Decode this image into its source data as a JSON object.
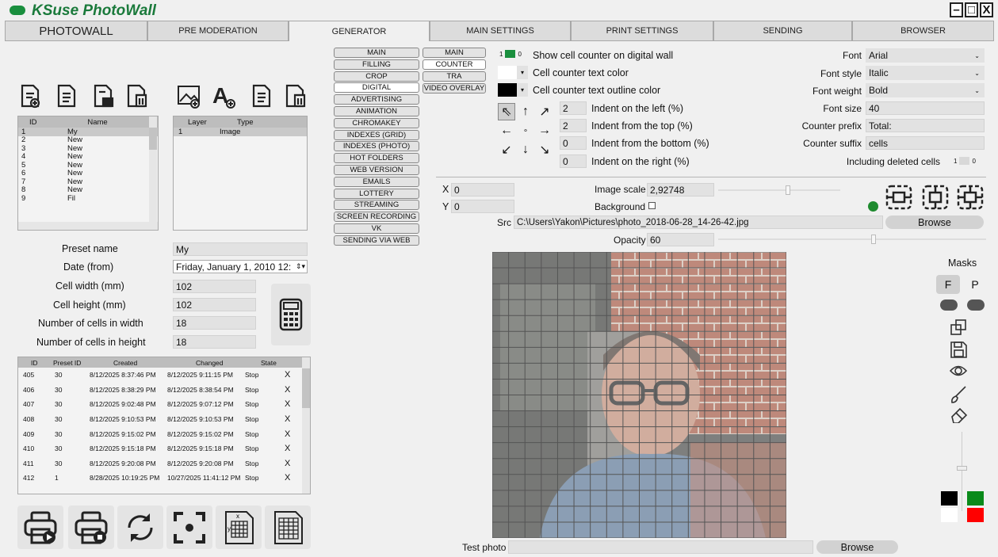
{
  "app": {
    "title": "KSuse PhotoWall"
  },
  "window_controls": {
    "minimize": "–",
    "maximize": "□",
    "close": "X"
  },
  "tabs": [
    "PHOTOWALL",
    "PRE MODERATION",
    "GENERATOR",
    "MAIN SETTINGS",
    "PRINT SETTINGS",
    "SENDING",
    "BROWSER"
  ],
  "presets_table": {
    "headers": [
      "ID",
      "Name"
    ],
    "rows": [
      [
        "1",
        "My"
      ],
      [
        "2",
        "New"
      ],
      [
        "3",
        "New"
      ],
      [
        "4",
        "New"
      ],
      [
        "5",
        "New"
      ],
      [
        "6",
        "New"
      ],
      [
        "7",
        "New"
      ],
      [
        "8",
        "New"
      ],
      [
        "9",
        "Fil"
      ]
    ]
  },
  "layers_table": {
    "headers": [
      "Layer",
      "Type"
    ],
    "rows": [
      [
        "1",
        "Image"
      ]
    ]
  },
  "preset_form": {
    "preset_name_label": "Preset name",
    "preset_name": "My",
    "date_label": "Date (from)",
    "date": "Friday, January 1, 2010 12:",
    "cell_width_label": "Cell width (mm)",
    "cell_width": "102",
    "cell_height_label": "Cell height (mm)",
    "cell_height": "102",
    "cells_w_label": "Number of cells in width",
    "cells_w": "18",
    "cells_h_label": "Number of cells in height",
    "cells_h": "18"
  },
  "jobs_table": {
    "headers": [
      "ID",
      "Preset ID",
      "Created",
      "Changed",
      "State"
    ],
    "rows": [
      [
        "405",
        "30",
        "8/12/2025 8:37:46 PM",
        "8/12/2025 9:11:15 PM",
        "Stop"
      ],
      [
        "406",
        "30",
        "8/12/2025 8:38:29 PM",
        "8/12/2025 8:38:54 PM",
        "Stop"
      ],
      [
        "407",
        "30",
        "8/12/2025 9:02:48 PM",
        "8/12/2025 9:07:12 PM",
        "Stop"
      ],
      [
        "408",
        "30",
        "8/12/2025 9:10:53 PM",
        "8/12/2025 9:10:53 PM",
        "Stop"
      ],
      [
        "409",
        "30",
        "8/12/2025 9:15:02 PM",
        "8/12/2025 9:15:02 PM",
        "Stop"
      ],
      [
        "410",
        "30",
        "8/12/2025 9:15:18 PM",
        "8/12/2025 9:15:18 PM",
        "Stop"
      ],
      [
        "411",
        "30",
        "8/12/2025 9:20:08 PM",
        "8/12/2025 9:20:08 PM",
        "Stop"
      ],
      [
        "412",
        "1",
        "8/28/2025 10:19:25 PM",
        "10/27/2025 11:41:12 PM",
        "Stop"
      ]
    ],
    "delete_mark": "X"
  },
  "gen_menu": [
    "MAIN",
    "FILLING",
    "CROP",
    "DIGITAL",
    "ADVERTISING",
    "ANIMATION",
    "CHROMAKEY",
    "INDEXES (GRID)",
    "INDEXES (PHOTO)",
    "HOT FOLDERS",
    "WEB VERSION",
    "EMAILS",
    "LOTTERY",
    "STREAMING",
    "SCREEN RECORDING",
    "VK",
    "SENDING VIA WEB"
  ],
  "sub_menu": [
    "MAIN",
    "COUNTER",
    "TRA",
    "VIDEO OVERLAY"
  ],
  "counter": {
    "toggle_on": "1",
    "toggle_off": "0",
    "show_label": "Show cell counter on digital wall",
    "text_color_label": "Cell counter text color",
    "outline_color_label": "Cell counter text outline color",
    "indent_left": "2",
    "indent_left_label": "Indent on the left (%)",
    "indent_top": "2",
    "indent_top_label": "Indent from the top (%)",
    "indent_bottom": "0",
    "indent_bottom_label": "Indent from the bottom (%)",
    "indent_right": "0",
    "indent_right_label": "Indent on the right (%)",
    "font_label": "Font",
    "font": "Arial",
    "font_style_label": "Font style",
    "font_style": "Italic",
    "font_weight_label": "Font weight",
    "font_weight": "Bold",
    "font_size_label": "Font size",
    "font_size": "40",
    "prefix_label": "Counter prefix",
    "prefix": "Total:",
    "suffix_label": "Counter suffix",
    "suffix": "cells",
    "deleted_label": "Including deleted cells",
    "deleted_on": "1",
    "deleted_off": "0"
  },
  "image": {
    "x_label": "X",
    "x": "0",
    "y_label": "Y",
    "y": "0",
    "scale_label": "Image scale",
    "scale": "2,92748",
    "background_label": "Background",
    "src_label": "Src",
    "src": "C:\\Users\\Yakon\\Pictures\\photo_2018-06-28_14-26-42.jpg",
    "browse": "Browse",
    "opacity_label": "Opacity",
    "opacity": "60"
  },
  "masks": {
    "label": "Masks",
    "f": "F",
    "p": "P"
  },
  "test_photo": {
    "label": "Test photo",
    "value": "",
    "browse": "Browse"
  },
  "colors": {
    "accent": "#1a8f3e",
    "status_dot": "#1e8a2e",
    "swatches": [
      "#000000",
      "#0a8a1a",
      "#ffffff",
      "#ff0000"
    ]
  }
}
